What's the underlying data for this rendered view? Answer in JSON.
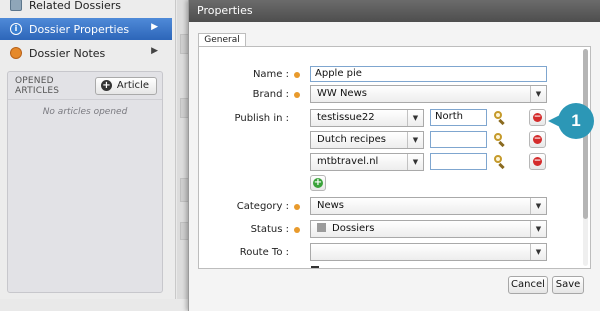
{
  "sidebar": {
    "items": [
      {
        "label": "Related Dossiers",
        "icon": "related-dossiers-icon"
      },
      {
        "label": "Dossier Properties",
        "icon": "info-icon"
      },
      {
        "label": "Dossier Notes",
        "icon": "notes-icon"
      }
    ],
    "opened_articles": {
      "title": "OPENED ARTICLES",
      "article_button": "Article",
      "empty_text": "No articles opened"
    }
  },
  "dialog": {
    "title": "Properties",
    "tab": "General",
    "fields": {
      "name": {
        "label": "Name :",
        "value": "Apple pie"
      },
      "brand": {
        "label": "Brand :",
        "value": "WW News"
      },
      "publish_in": {
        "label": "Publish in :",
        "rows": [
          {
            "channel": "testissue22",
            "edition": "North"
          },
          {
            "channel": "Dutch recipes",
            "edition": ""
          },
          {
            "channel": "mtbtravel.nl",
            "edition": ""
          }
        ]
      },
      "category": {
        "label": "Category :",
        "value": "News"
      },
      "status": {
        "label": "Status :",
        "value": "Dossiers"
      },
      "route_to": {
        "label": "Route To :",
        "value": ""
      }
    },
    "buttons": {
      "cancel": "Cancel",
      "save": "Save"
    }
  },
  "callout": {
    "number": "1"
  },
  "colors": {
    "selected_item": "#3a75c9",
    "required_marker": "#e89a2c",
    "callout": "#2c97b6",
    "remove_button": "#d42b2b",
    "add_button": "#3aa33a"
  }
}
